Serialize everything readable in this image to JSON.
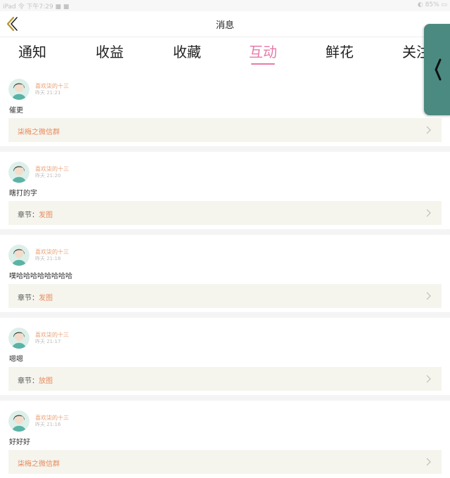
{
  "status_bar": {
    "left": "iPad 令 下午7:29 ■ ■",
    "right": "◐ 85% ▭"
  },
  "nav": {
    "title": "消息",
    "back_icon": "chevron-left-icon"
  },
  "tabs": [
    {
      "label": "通知"
    },
    {
      "label": "收益"
    },
    {
      "label": "收藏"
    },
    {
      "label": "互动",
      "active": true
    },
    {
      "label": "鲜花"
    },
    {
      "label": "关注"
    }
  ],
  "colors": {
    "accent": "#e77aa8",
    "username": "#e8a074",
    "link": "#e8895a",
    "ref_bg": "#f5f5ee",
    "float_tab": "#4a8a80"
  },
  "items": [
    {
      "user": "喜欢柒的十三",
      "time": "昨天 21:21",
      "content": "催更",
      "ref_label": "",
      "ref_value": "柒梅之微信群"
    },
    {
      "user": "喜欢柒的十三",
      "time": "昨天 21:20",
      "content": "瞎打的字",
      "ref_label": "章节：",
      "ref_value": "发图"
    },
    {
      "user": "喜欢柒的十三",
      "time": "昨天 21:18",
      "content": "噗哈哈哈哈哈哈哈哈",
      "ref_label": "章节：",
      "ref_value": "发图"
    },
    {
      "user": "喜欢柒的十三",
      "time": "昨天 21:17",
      "content": "嗯嗯",
      "ref_label": "章节：",
      "ref_value": "放图"
    },
    {
      "user": "喜欢柒的十三",
      "time": "昨天 21:16",
      "content": "好好好",
      "ref_label": "",
      "ref_value": "柒梅之微信群"
    }
  ]
}
